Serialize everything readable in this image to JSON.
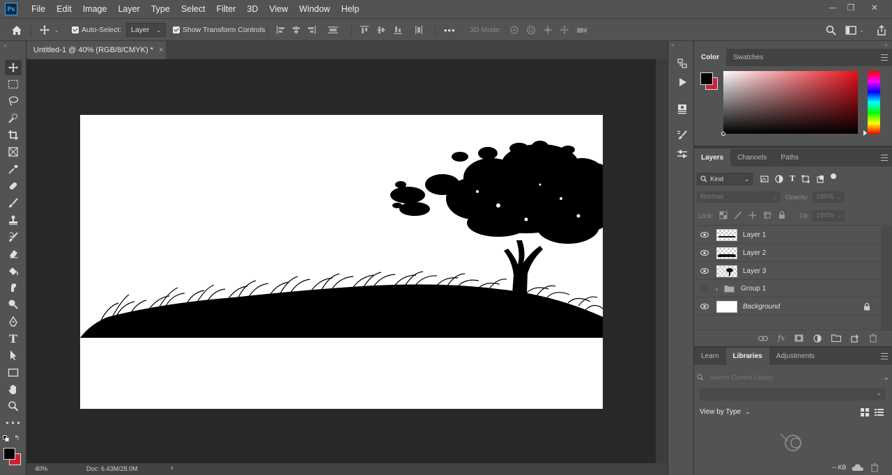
{
  "app": {
    "logo": "Ps"
  },
  "menu": [
    "File",
    "Edit",
    "Image",
    "Layer",
    "Type",
    "Select",
    "Filter",
    "3D",
    "View",
    "Window",
    "Help"
  ],
  "window_controls": {
    "minimize": "—",
    "restore": "❐",
    "close": "✕"
  },
  "options_bar": {
    "auto_select_label": "Auto-Select:",
    "auto_select_value": "Layer",
    "show_transform_label": "Show Transform Controls",
    "more_label": "•••",
    "mode_3d_label": "3D Mode:"
  },
  "document": {
    "tab_title": "Untitled-1 @ 40% (RGB/8/CMYK) *",
    "tab_close": "×",
    "zoom": "40%",
    "doc_info": "Doc: 6.43M/28.0M",
    "status_arrow": "›"
  },
  "color_panel": {
    "tabs": [
      "Color",
      "Swatches"
    ],
    "foreground": "#000000",
    "background": "#cc2233",
    "spectrum_hue": "#e8101a"
  },
  "layers_panel": {
    "tabs": [
      "Layers",
      "Channels",
      "Paths"
    ],
    "filter_kind": "Kind",
    "blend_mode": "Normal",
    "opacity_label": "Opacity:",
    "opacity_value": "100%",
    "lock_label": "Lock:",
    "fill_label": "Fill:",
    "fill_value": "100%",
    "layers": [
      {
        "name": "Layer 1",
        "visible": true,
        "type": "layer"
      },
      {
        "name": "Layer 2",
        "visible": true,
        "type": "layer"
      },
      {
        "name": "Layer 3",
        "visible": true,
        "type": "layer"
      },
      {
        "name": "Group 1",
        "visible": false,
        "type": "group"
      },
      {
        "name": "Background",
        "visible": true,
        "type": "background",
        "locked": true
      }
    ]
  },
  "libraries_panel": {
    "tabs": [
      "Learn",
      "Libraries",
      "Adjustments"
    ],
    "search_placeholder": "Search Current Library",
    "view_by": "View by Type",
    "size_label": "-- KB"
  }
}
